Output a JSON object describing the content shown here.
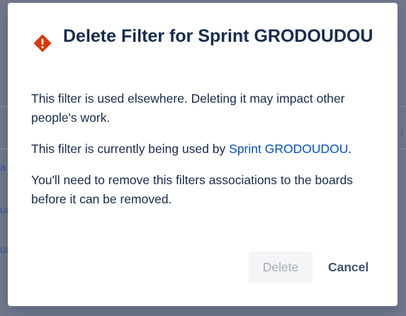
{
  "background": {
    "link_fragments": [
      "a",
      "ua",
      "ua"
    ],
    "right_mark": "l"
  },
  "dialog": {
    "icon": "warning-diamond-icon",
    "title": "Delete Filter for Sprint GRODOUDOU",
    "paragraph1": "This filter is used elsewhere. Deleting it may impact other people's work.",
    "paragraph2_prefix": "This filter is currently being used by ",
    "paragraph2_link": "Sprint GRODOUDOU",
    "paragraph2_suffix": ".",
    "paragraph3": "You'll need to remove this filters associations to the boards before it can be removed.",
    "delete_label": "Delete",
    "cancel_label": "Cancel"
  },
  "colors": {
    "danger": "#de350b",
    "link": "#0052cc",
    "text": "#172b4d",
    "overlay": "#747a8c"
  }
}
